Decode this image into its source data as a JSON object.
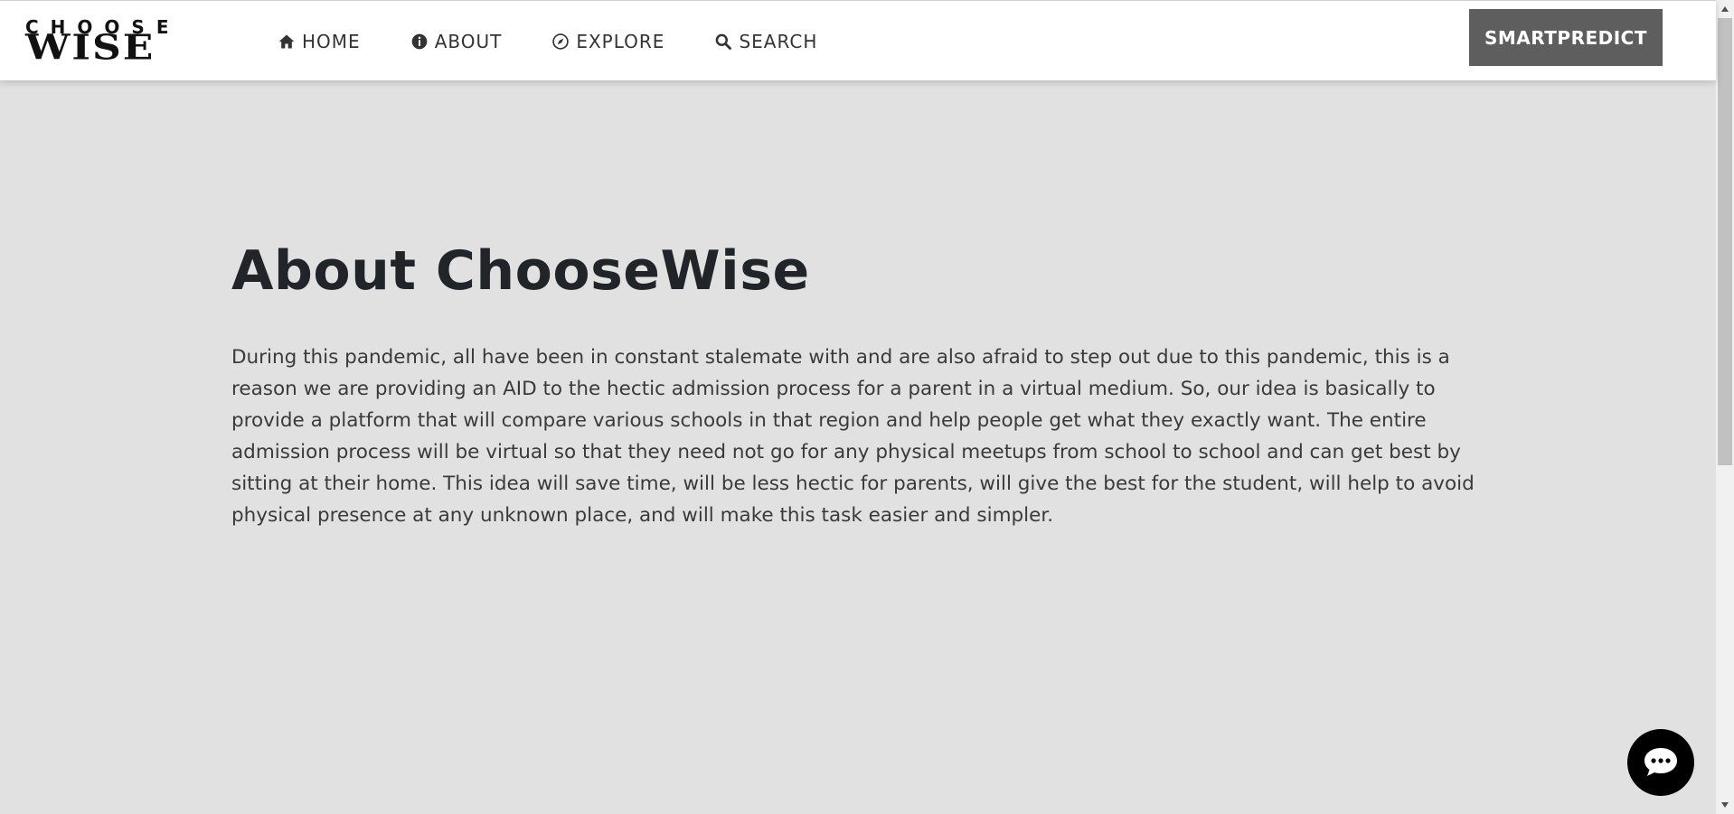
{
  "logo": {
    "top_text": "CHOOSE",
    "bottom_text": "WISE"
  },
  "nav": {
    "items": [
      {
        "label": "HOME",
        "icon": "home-icon"
      },
      {
        "label": "ABOUT",
        "icon": "info-icon"
      },
      {
        "label": "EXPLORE",
        "icon": "compass-icon"
      },
      {
        "label": "SEARCH",
        "icon": "search-icon"
      }
    ],
    "cta_label": "SMARTPREDICT"
  },
  "main": {
    "title": "About ChooseWise",
    "body": "During this pandemic, all have been in constant stalemate with and are also afraid to step out due to this pandemic, this is a reason we are providing an AID to the hectic admission process for a parent in a virtual medium. So, our idea is basically to provide a platform that will compare various schools in that region and help people get what they exactly want. The entire admission process will be virtual so that they need not go for any physical meetups from school to school and can get best by sitting at their home. This idea will save time, will be less hectic for parents, will give the best for the student, will help to avoid physical presence at any unknown place, and will make this task easier and simpler."
  },
  "chat": {
    "icon": "chat-icon"
  },
  "colors": {
    "background": "#e1e1e1",
    "navbar": "#ffffff",
    "cta_button": "#5e5e5e",
    "chat_button": "#000000",
    "title_text": "#212529"
  }
}
